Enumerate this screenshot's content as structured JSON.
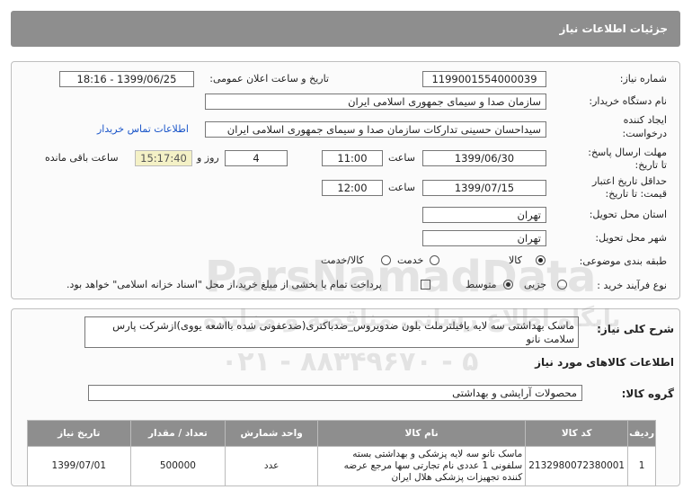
{
  "header": {
    "title": "جزئیات اطلاعات نیاز"
  },
  "form": {
    "need_number": {
      "label": "شماره نیاز:",
      "value": "1199001554000039"
    },
    "announce_datetime": {
      "label": "تاریخ و ساعت اعلان عمومی:",
      "value": "1399/06/25 - 18:16"
    },
    "buyer_org": {
      "label": "نام دستگاه خریدار:",
      "value": "سازمان صدا و سیمای جمهوری اسلامی ایران"
    },
    "requester": {
      "label_line1": "ایجاد کننده",
      "label_line2": "درخواست:",
      "value": "سیداحسان حسینی تدارکات سازمان صدا و سیمای جمهوری اسلامی ایران",
      "contact_link": "اطلاعات تماس خریدار"
    },
    "deadline": {
      "label_line1": "مهلت ارسال پاسخ:",
      "label_line2": "تا تاریخ:",
      "date": "1399/06/30",
      "time_label": "ساعت",
      "time": "11:00",
      "days": "4",
      "days_label": "روز و",
      "remaining_time": "15:17:40",
      "remaining_label": "ساعت باقی مانده"
    },
    "price_validity": {
      "label_line1": "حداقل تاریخ اعتبار",
      "label_line2": "قیمت: تا تاریخ:",
      "date": "1399/07/15",
      "time_label": "ساعت",
      "time": "12:00"
    },
    "province": {
      "label": "استان محل تحویل:",
      "value": "تهران"
    },
    "city": {
      "label": "شهر محل تحویل:",
      "value": "تهران"
    },
    "category": {
      "label": "طبقه بندی موضوعی:",
      "options": [
        "کالا",
        "خدمت",
        "کالا/خدمت"
      ],
      "selected": 0
    },
    "purchase_process": {
      "label": "نوع فرآیند خرید :",
      "options": [
        "جزیی",
        "متوسط"
      ],
      "selected": 1,
      "note": "پرداخت تمام یا بخشی از مبلغ خرید،از محل \"اسناد خزانه اسلامی\" خواهد بود."
    }
  },
  "summary": {
    "label": "شرح کلی نیاز:",
    "text": "ماسک بهداشتی سه لایه بافیلترملت بلون ضدویروس_ضدباکتری(ضدعفونی شده بااشعه یووی)ازشرکت پارس سلامت نانو"
  },
  "goods": {
    "title": "اطلاعات کالاهای مورد نیاز",
    "group_label": "گروه کالا:",
    "group_value": "محصولات آرایشی و بهداشتی",
    "table": {
      "headers": [
        "ردیف",
        "کد کالا",
        "نام کالا",
        "واحد شمارش",
        "تعداد / مقدار",
        "تاریخ نیاز"
      ],
      "rows": [
        {
          "row": "1",
          "code": "2132980072380001",
          "name": "ماسک نانو سه لایه پزشکی و بهداشتی بسته سلفونی 1 عددی نام تجارتی سها مرجع عرضه کننده تجهیزات پزشکی هلال ایران",
          "unit": "عدد",
          "qty": "500000",
          "date": "1399/07/01"
        }
      ]
    }
  },
  "watermark": {
    "brand": "ParsNamadData",
    "subtitle": "پایگاه اطلاع رسانی مناقصه و مزایده",
    "phone": "۰۲۱ - ۸۸۳۴۹۶۷۰ - ۵"
  },
  "colors": {
    "header_bg": "#8e8e8e",
    "link": "#1a55c9",
    "highlight": "#f4f1c6"
  }
}
